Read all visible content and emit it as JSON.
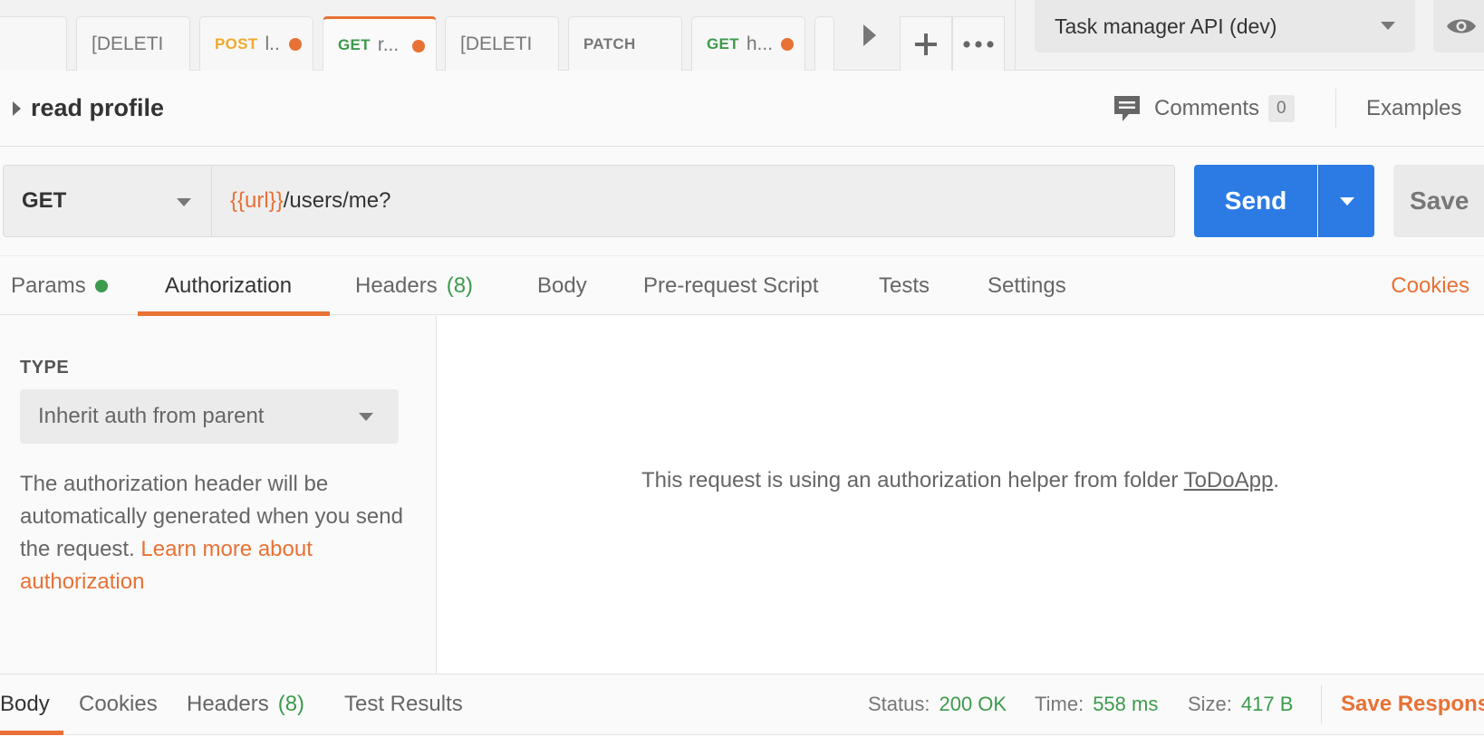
{
  "tabs": [
    {
      "method": "",
      "name": "..",
      "dot": false,
      "active": false
    },
    {
      "method": "",
      "name": "[DELETI",
      "dot": false,
      "active": false
    },
    {
      "method": "POST",
      "name": "l..",
      "dot": true,
      "active": false,
      "method_color": "#f0a92c"
    },
    {
      "method": "GET",
      "name": "r...",
      "dot": true,
      "active": true,
      "method_color": "#3c9a4c"
    },
    {
      "method": "",
      "name": "[DELETI",
      "dot": false,
      "active": false
    },
    {
      "method": "PATCH",
      "name": "",
      "dot": false,
      "active": false,
      "method_color": "#777777"
    },
    {
      "method": "GET",
      "name": "h...",
      "dot": true,
      "active": false,
      "method_color": "#3c9a4c"
    }
  ],
  "environment": {
    "selected": "Task manager API (dev)"
  },
  "request": {
    "name": "read profile",
    "comments_label": "Comments",
    "comments_count": "0",
    "examples_label": "Examples",
    "method": "GET",
    "url_var": "{{url}}",
    "url_path": "/users/me?",
    "send_label": "Send",
    "save_label": "Save"
  },
  "request_tabs": {
    "params": "Params",
    "authorization": "Authorization",
    "headers": "Headers",
    "headers_count": "(8)",
    "body": "Body",
    "pre_request": "Pre-request Script",
    "tests": "Tests",
    "settings": "Settings",
    "cookies": "Cookies"
  },
  "auth": {
    "type_label": "TYPE",
    "type_value": "Inherit auth from parent",
    "description": "The authorization header will be automatically generated when you send the request. ",
    "learn_more": "Learn more about authorization",
    "helper_message_prefix": "This request is using an authorization helper from folder ",
    "helper_folder": "ToDoApp",
    "helper_message_suffix": "."
  },
  "response": {
    "tabs": {
      "body": "Body",
      "cookies": "Cookies",
      "headers": "Headers",
      "headers_count": "(8)",
      "test_results": "Test Results"
    },
    "status_label": "Status:",
    "status_value": "200 OK",
    "time_label": "Time:",
    "time_value": "558 ms",
    "size_label": "Size:",
    "size_value": "417 B",
    "save_response": "Save Respons"
  },
  "colors": {
    "accent": "#e87135",
    "send_blue": "#2c7be5",
    "success_green": "#3c9a4c",
    "post_yellow": "#f0a92c"
  }
}
